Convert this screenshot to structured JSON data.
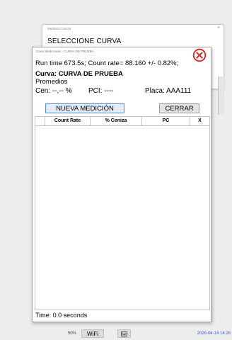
{
  "background_window": {
    "title": "Medición Ceniza",
    "close_glyph": "×",
    "heading": "SELECCIONE CURVA"
  },
  "main_window": {
    "title": "Crear Mediciones - CURVA DE PRUEBA",
    "close_icon": "red-circle-x-icon",
    "runtime_text": "Run time 673.5s; Count rate= 88.160 +/- 0.82%;",
    "curva_text": "Curva: CURVA DE PRUEBA",
    "promedios_label": "Promedios",
    "cen_text": "Cen: --,-- %",
    "pci_text": "PCI:  ----",
    "placa_text": "Placa: AAA111",
    "nueva_button": "NUEVA MEDICIÓN",
    "cerrar_button": "CERRAR",
    "table_headers": [
      "",
      "Count Rate",
      "% Ceniza",
      "PC",
      "X"
    ],
    "time_text": "Time: 0.0 seconds"
  },
  "taskbar": {
    "zoom": "50%",
    "wifi_button": "WiFi",
    "keyboard_icon": "keyboard-icon",
    "datetime": "2026-04-14  14:26"
  },
  "colors": {
    "close_icon_red": "#e0201a",
    "focus_border": "#4b8fd8",
    "datetime_blue": "#3a5ed0"
  }
}
